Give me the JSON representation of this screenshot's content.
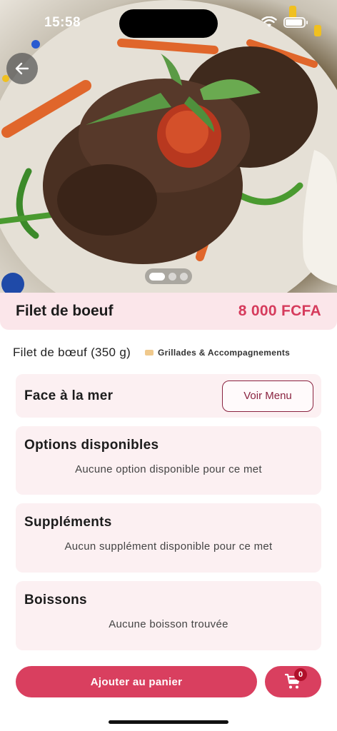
{
  "status_bar": {
    "time": "15:58",
    "icons": [
      "wifi-icon",
      "battery-icon"
    ]
  },
  "hero": {
    "image": "grilled-beef-fillet-photo",
    "carousel": {
      "pages": 3,
      "active_page": 1
    }
  },
  "dish": {
    "title": "Filet de boeuf",
    "price": "8 000 FCFA",
    "description": "Filet de bœuf (350 g)",
    "category": "Grillades & Accompagnements"
  },
  "restaurant": {
    "name": "Face à la mer",
    "menu_button_label": "Voir Menu"
  },
  "sections": {
    "options": {
      "title": "Options disponibles",
      "empty_text": "Aucune option disponible pour ce met"
    },
    "supplements": {
      "title": "Suppléments",
      "empty_text": "Aucun supplément disponible pour ce met"
    },
    "drinks": {
      "title": "Boissons",
      "empty_text": "Aucune boisson trouvée"
    }
  },
  "actions": {
    "add_to_cart_label": "Ajouter au panier",
    "cart_count": "0"
  },
  "colors": {
    "accent": "#d93f5f",
    "price": "#d63b5c",
    "title_bar_bg": "#fbe6ea",
    "card_bg": "#fcf0f2",
    "menu_button": "#8a2340"
  }
}
